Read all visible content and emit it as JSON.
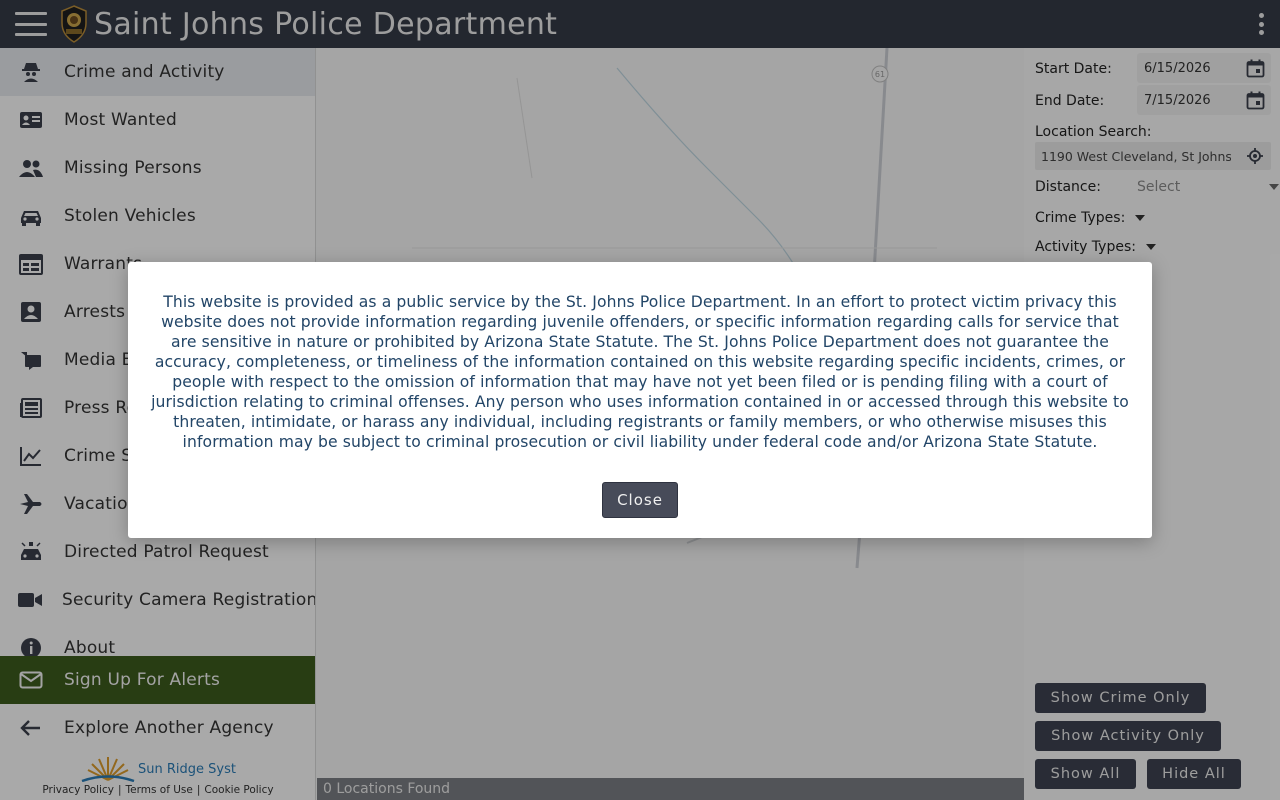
{
  "header": {
    "title": "Saint Johns Police Department",
    "bg_color": "#343a46"
  },
  "sidebar": {
    "items": [
      {
        "label": "Crime and Activity",
        "icon": "spy-icon",
        "active": true
      },
      {
        "label": "Most Wanted",
        "icon": "id-card-icon"
      },
      {
        "label": "Missing Persons",
        "icon": "users-icon"
      },
      {
        "label": "Stolen Vehicles",
        "icon": "car-icon"
      },
      {
        "label": "Warrants",
        "icon": "calendar-list-icon"
      },
      {
        "label": "Arrests",
        "icon": "person-badge-icon"
      },
      {
        "label": "Media Briefings",
        "icon": "media-icon"
      },
      {
        "label": "Press Releases",
        "icon": "newspaper-icon"
      },
      {
        "label": "Crime Statistics",
        "icon": "line-chart-icon"
      },
      {
        "label": "Vacation Watch",
        "icon": "airplane-icon"
      },
      {
        "label": "Directed Patrol Request",
        "icon": "police-car-icon"
      },
      {
        "label": "Security Camera Registration",
        "icon": "video-camera-icon"
      },
      {
        "label": "About",
        "icon": "info-icon"
      }
    ],
    "alerts_label": "Sign Up For Alerts",
    "explore_label": "Explore Another Agency",
    "alerts_color": "#3c5a1c"
  },
  "footer": {
    "brand": "Sun Ridge Syst",
    "privacy": "Privacy Policy",
    "terms": "Terms of Use",
    "cookie": "Cookie Policy",
    "sep": "|"
  },
  "map": {
    "locations_found": "0 Locations Found",
    "route_label": "61"
  },
  "panel": {
    "start_date_label": "Start Date:",
    "start_date_value": "6/15/2026",
    "end_date_label": "End Date:",
    "end_date_value": "7/15/2026",
    "location_label": "Location Search:",
    "location_value": "1190 West Cleveland, St Johns",
    "distance_label": "Distance:",
    "distance_placeholder": "Select",
    "crime_types_label": "Crime Types:",
    "activity_types_label": "Activity Types:",
    "show_crime_only": "Show Crime Only",
    "show_activity_only": "Show Activity Only",
    "show_all": "Show All",
    "hide_all": "Hide All"
  },
  "modal": {
    "text": "This website is provided as a public service by the St. Johns Police Department. In an effort to protect victim privacy this website does not provide information regarding juvenile offenders, or specific information regarding calls for service that are sensitive in nature or prohibited by Arizona State Statute. The St. Johns Police Department does not guarantee the accuracy, completeness, or timeliness of the information contained on this website regarding specific incidents, crimes, or people with respect to the omission of information that may have not yet been filed or is pending filing with a court of jurisdiction relating to criminal offenses. Any person who uses information contained in or accessed through this website to threaten, intimidate, or harass any individual, including registrants or family members, or who otherwise misuses this information may be subject to criminal prosecution or civil liability under federal code and/or Arizona State Statute.",
    "close_label": "Close"
  }
}
